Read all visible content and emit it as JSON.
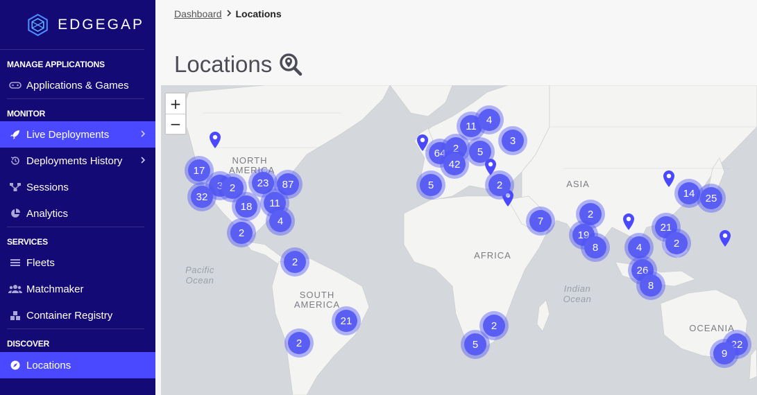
{
  "brand": {
    "name": "EDGEGAP"
  },
  "sidebar": {
    "sections": [
      {
        "title": "MANAGE APPLICATIONS"
      },
      {
        "title": "MONITOR"
      },
      {
        "title": "SERVICES"
      },
      {
        "title": "DISCOVER"
      }
    ],
    "items": [
      {
        "label": "Applications & Games",
        "icon": "gamepad-icon"
      },
      {
        "label": "Live Deployments",
        "icon": "rocket-icon",
        "active": true
      },
      {
        "label": "Deployments History",
        "icon": "history-icon"
      },
      {
        "label": "Sessions",
        "icon": "sessions-icon"
      },
      {
        "label": "Analytics",
        "icon": "pie-chart-icon"
      },
      {
        "label": "Fleets",
        "icon": "list-icon"
      },
      {
        "label": "Matchmaker",
        "icon": "users-icon"
      },
      {
        "label": "Container Registry",
        "icon": "boxes-icon"
      },
      {
        "label": "Locations",
        "icon": "compass-icon",
        "active": true
      }
    ]
  },
  "breadcrumb": {
    "parent": "Dashboard",
    "separator": ">",
    "current": "Locations"
  },
  "page": {
    "title": "Locations",
    "title_icon": "map-search-icon"
  },
  "map": {
    "zoom_in": "+",
    "zoom_out": "−",
    "continent_labels": {
      "north_america_1": "NORTH",
      "north_america_2": "AMERICA",
      "south_america_1": "SOUTH",
      "south_america_2": "AMERICA",
      "africa": "AFRICA",
      "asia": "ASIA",
      "oceania": "OCEANIA"
    },
    "ocean_labels": {
      "pacific_1": "Pacific",
      "pacific_2": "Ocean",
      "indian_1": "Indian",
      "indian_2": "Ocean"
    },
    "clusters": [
      "17",
      "3",
      "2",
      "32",
      "23",
      "87",
      "18",
      "11",
      "4",
      "2",
      "2",
      "21",
      "2",
      "11",
      "4",
      "3",
      "64",
      "2",
      "42",
      "5",
      "5",
      "2",
      "7",
      "2",
      "19",
      "8",
      "4",
      "26",
      "8",
      "21",
      "2",
      "14",
      "25",
      "2",
      "5",
      "22",
      "9"
    ]
  },
  "colors": {
    "sidebar": "#140a75",
    "accent": "#4b49ff",
    "cluster": "#5a5ef2",
    "map_bg": "#d4d8dc",
    "land": "#f4f4f3"
  }
}
